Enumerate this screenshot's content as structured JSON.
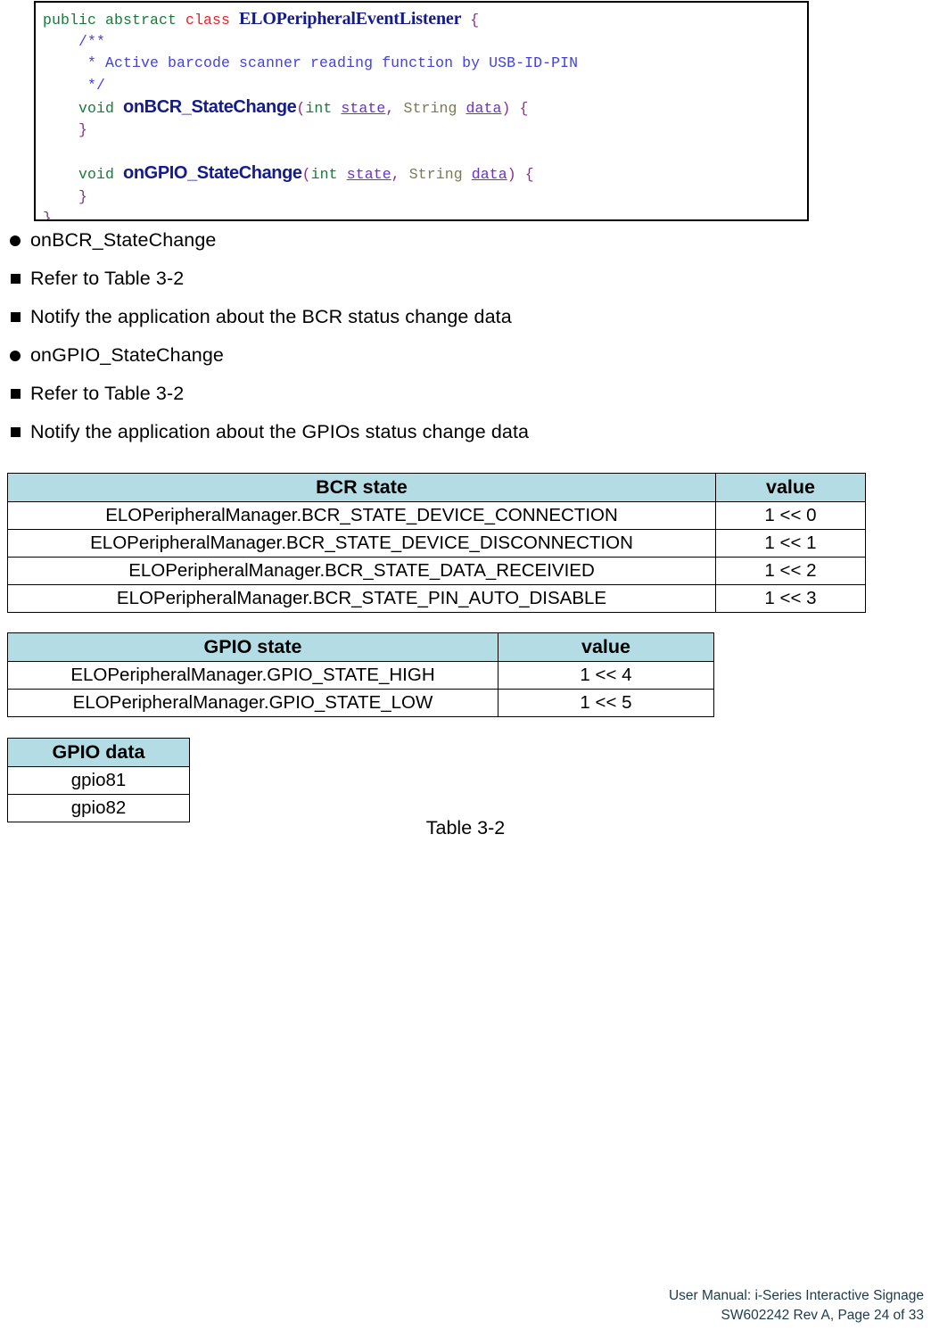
{
  "code_block": {
    "lines": [
      [
        {
          "t": "public abstract ",
          "c": "kw"
        },
        {
          "t": "class ",
          "c": "kw-red"
        },
        {
          "t": "ELOPeripheralEventListener",
          "c": "cname"
        },
        {
          "t": " {",
          "c": "punc"
        }
      ],
      [
        {
          "t": "    ",
          "c": "plain"
        },
        {
          "t": "/**",
          "c": "cmt"
        }
      ],
      [
        {
          "t": "     ",
          "c": "plain"
        },
        {
          "t": "* Active barcode scanner reading function by USB-ID-PIN",
          "c": "cmt"
        }
      ],
      [
        {
          "t": "     ",
          "c": "plain"
        },
        {
          "t": "*/",
          "c": "cmt"
        }
      ],
      [
        {
          "t": "    ",
          "c": "plain"
        },
        {
          "t": "void ",
          "c": "kw"
        },
        {
          "t": "onBCR_StateChange",
          "c": "mname"
        },
        {
          "t": "(",
          "c": "punc"
        },
        {
          "t": "int ",
          "c": "kw"
        },
        {
          "t": "state",
          "c": "var"
        },
        {
          "t": ", ",
          "c": "punc"
        },
        {
          "t": "String ",
          "c": "type"
        },
        {
          "t": "data",
          "c": "var"
        },
        {
          "t": ") {",
          "c": "punc"
        }
      ],
      [
        {
          "t": "    ",
          "c": "plain"
        },
        {
          "t": "}",
          "c": "punc"
        }
      ],
      [
        {
          "t": " ",
          "c": "plain"
        }
      ],
      [
        {
          "t": "    ",
          "c": "plain"
        },
        {
          "t": "void ",
          "c": "kw"
        },
        {
          "t": "onGPIO_StateChange",
          "c": "mname"
        },
        {
          "t": "(",
          "c": "punc"
        },
        {
          "t": "int ",
          "c": "kw"
        },
        {
          "t": "state",
          "c": "var"
        },
        {
          "t": ", ",
          "c": "punc"
        },
        {
          "t": "String ",
          "c": "type"
        },
        {
          "t": "data",
          "c": "var"
        },
        {
          "t": ") {",
          "c": "punc"
        }
      ],
      [
        {
          "t": "    ",
          "c": "plain"
        },
        {
          "t": "}",
          "c": "punc"
        }
      ],
      [
        {
          "t": "}",
          "c": "punc"
        }
      ]
    ]
  },
  "bullets": [
    {
      "marker": "disc",
      "text": "onBCR_StateChange"
    },
    {
      "marker": "square",
      "text": "Refer to Table 3-2"
    },
    {
      "marker": "square",
      "text": "Notify the application about the BCR status change data"
    },
    {
      "marker": "disc",
      "text": "onGPIO_StateChange"
    },
    {
      "marker": "square",
      "text": "Refer to Table 3-2"
    },
    {
      "marker": "square",
      "text": "Notify the application about the GPIOs status change data"
    }
  ],
  "bcr_table": {
    "headers": [
      "BCR state",
      "value"
    ],
    "rows": [
      [
        "ELOPeripheralManager.BCR_STATE_DEVICE_CONNECTION",
        "1 << 0"
      ],
      [
        "ELOPeripheralManager.BCR_STATE_DEVICE_DISCONNECTION",
        "1 << 1"
      ],
      [
        "ELOPeripheralManager.BCR_STATE_DATA_RECEIVIED",
        "1 << 2"
      ],
      [
        "ELOPeripheralManager.BCR_STATE_PIN_AUTO_DISABLE",
        "1 << 3"
      ]
    ]
  },
  "gpio_state_table": {
    "headers": [
      "GPIO state",
      "value"
    ],
    "rows": [
      [
        "ELOPeripheralManager.GPIO_STATE_HIGH",
        "1 << 4"
      ],
      [
        "ELOPeripheralManager.GPIO_STATE_LOW",
        "1 << 5"
      ]
    ]
  },
  "gpio_data_table": {
    "headers": [
      "GPIO data"
    ],
    "rows": [
      [
        "gpio81"
      ],
      [
        "gpio82"
      ]
    ]
  },
  "caption": {
    "text": "Table 3-2"
  },
  "footer": {
    "line1": "User Manual: i-Series Interactive Signage",
    "line2": "SW602242 Rev A, Page 24 of 33"
  },
  "colors": {
    "table_header_bg": "#b3dce5",
    "footer_text": "#1d3b49",
    "code_keyword": "#1a7a3c",
    "code_class_keyword": "#e8202a",
    "code_identifier": "#141c8c",
    "code_comment": "#4242e0",
    "code_punctuation": "#8a2f8a",
    "code_type": "#7a7a56",
    "code_variable": "#6a32c8"
  }
}
